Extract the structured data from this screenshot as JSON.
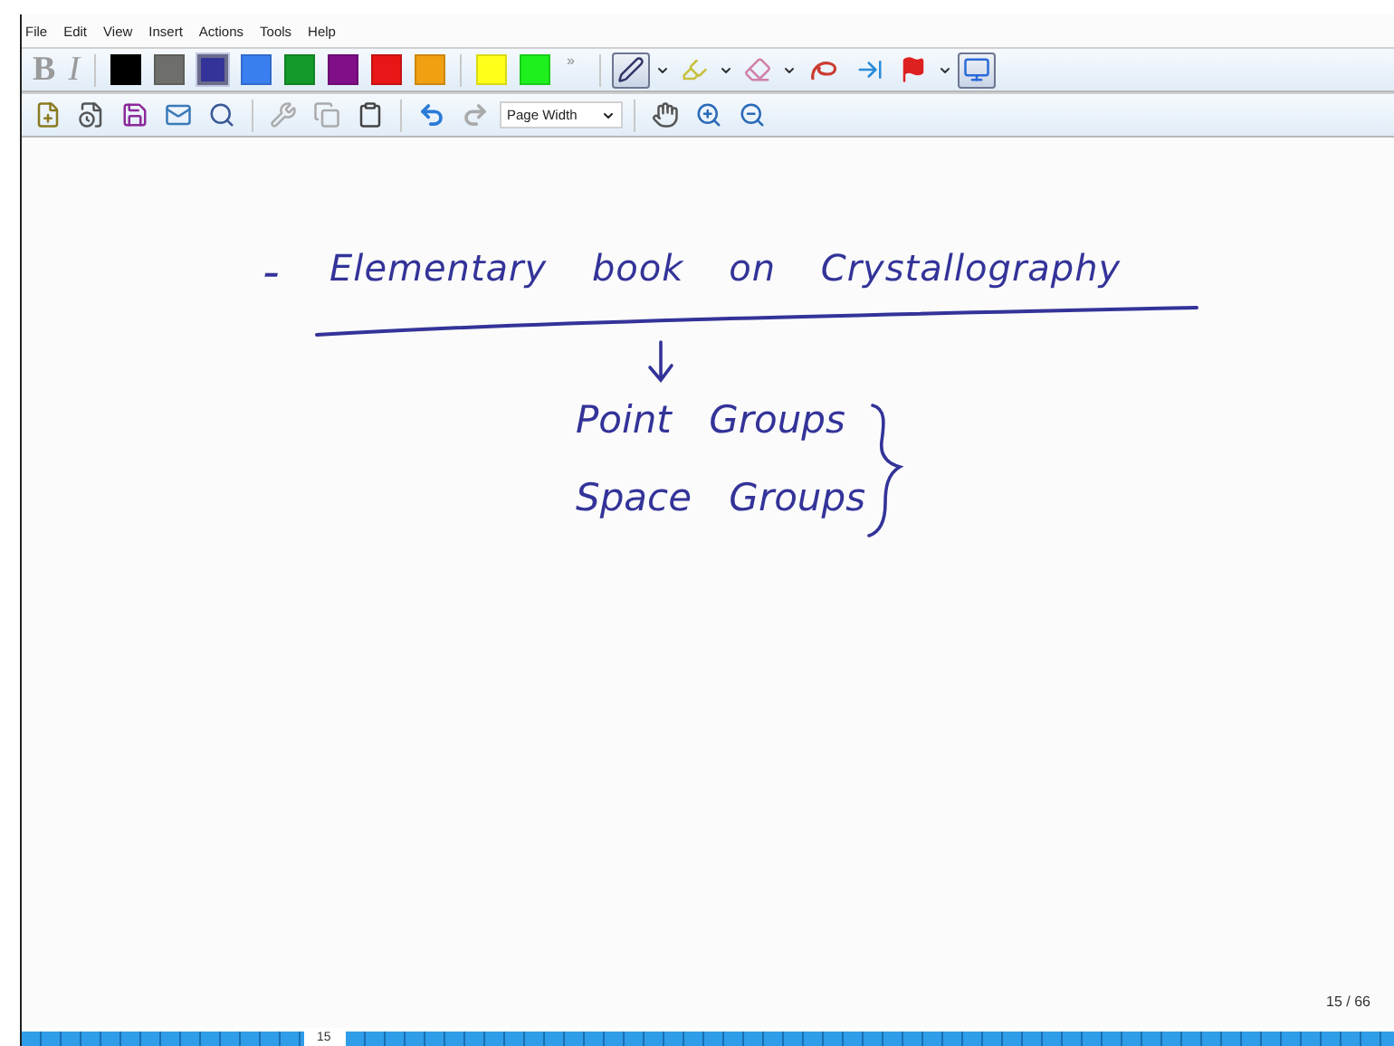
{
  "menu": [
    "File",
    "Edit",
    "View",
    "Insert",
    "Actions",
    "Tools",
    "Help"
  ],
  "format_buttons": [
    {
      "label": "B",
      "disabled": true
    },
    {
      "label": "I",
      "disabled": true
    }
  ],
  "pen_colors": [
    {
      "color": "#000000",
      "selected": false
    },
    {
      "color": "#6e6e6a",
      "selected": false
    },
    {
      "color": "#333399",
      "selected": true
    },
    {
      "color": "#3a7ff0",
      "selected": false
    },
    {
      "color": "#139a2a",
      "selected": false
    },
    {
      "color": "#800f88",
      "selected": false
    },
    {
      "color": "#e81616",
      "selected": false
    },
    {
      "color": "#f0a010",
      "selected": false
    },
    {
      "color": "#ffff1a",
      "selected": false
    },
    {
      "color": "#1ef01e",
      "selected": false
    }
  ],
  "overflow": "»",
  "tools": [
    {
      "kind": "pen",
      "selected": true
    },
    {
      "kind": "highlighter",
      "selected": false
    },
    {
      "kind": "eraser",
      "selected": false
    },
    {
      "kind": "lasso",
      "selected": false
    },
    {
      "kind": "space",
      "selected": false
    },
    {
      "kind": "flag",
      "selected": false
    },
    {
      "kind": "view",
      "selected": true
    }
  ],
  "zoom_select": {
    "value": "Page Width"
  },
  "ink": {
    "bullet": "-",
    "heading": "Elementary book on Crystallography",
    "items": [
      "Point Groups",
      "Space Groups"
    ]
  },
  "page_counter": "15 / 66",
  "current_page": "15"
}
